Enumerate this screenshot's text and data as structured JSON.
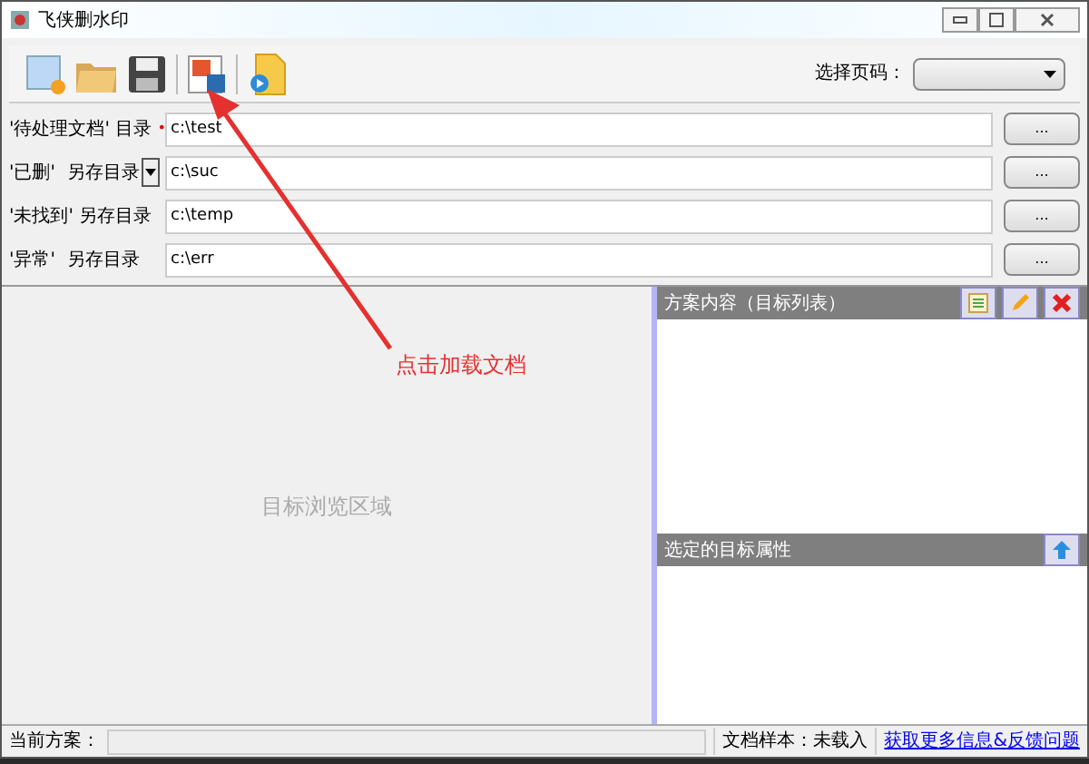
{
  "window": {
    "title": "飞侠删水印"
  },
  "toolbar": {
    "page_select_label": "选择页码："
  },
  "directories": [
    {
      "kind": "required",
      "label": "'待处理文档' 目录",
      "required_mark": "•",
      "value": "c:\\test",
      "browse": "..."
    },
    {
      "kind": "dropdown",
      "label": "'已删'  另存目录",
      "value": "c:\\suc",
      "browse": "..."
    },
    {
      "kind": "plain",
      "label": "'未找到' 另存目录",
      "value": "c:\\temp",
      "browse": "..."
    },
    {
      "kind": "plain",
      "label": "'异常'  另存目录",
      "value": "c:\\err",
      "browse": "..."
    }
  ],
  "preview": {
    "placeholder": "目标浏览区域"
  },
  "annotation": {
    "text": "点击加载文档"
  },
  "panels": [
    {
      "title": "方案内容（目标列表）",
      "kind": "list"
    },
    {
      "title": "选定的目标属性",
      "kind": "properties"
    }
  ],
  "status_bar": {
    "scheme_label": "当前方案：",
    "sample": "文档样本：未载入",
    "link": "获取更多信息&反馈问题"
  }
}
